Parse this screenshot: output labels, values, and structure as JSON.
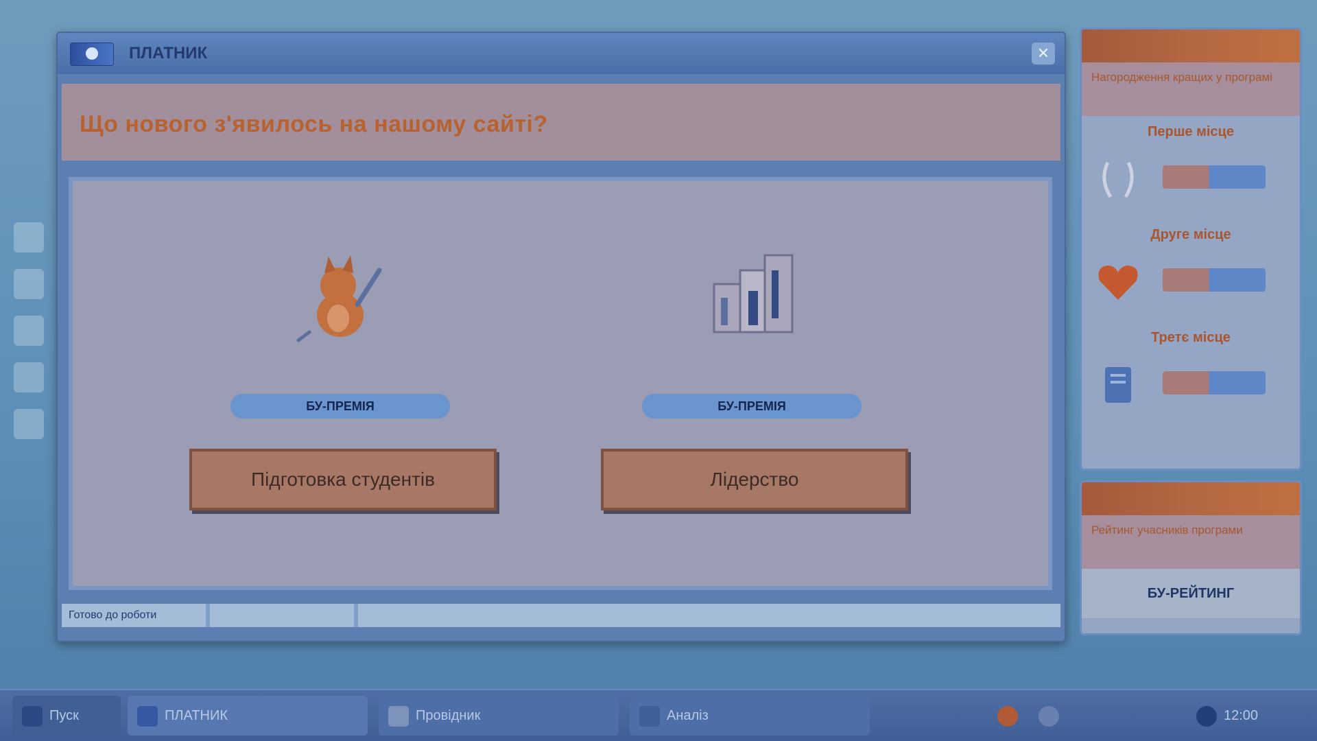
{
  "window": {
    "title": "ПЛАТНИК",
    "close_glyph": "✕"
  },
  "banner": {
    "text": "Що нового з'явилось на нашому сайті?"
  },
  "options": [
    {
      "badge": "БУ-ПРЕМІЯ",
      "button_label": "Підготовка студентів"
    },
    {
      "badge": "БУ-ПРЕМІЯ",
      "button_label": "Лідерство"
    }
  ],
  "statusbar": {
    "segments": [
      "Готово до роботи",
      "",
      ""
    ]
  },
  "right_panel": {
    "card1": {
      "subtitle": "Нагородження кращих у програмі",
      "prizes": [
        {
          "label": "Перше місце"
        },
        {
          "label": "Друге місце"
        },
        {
          "label": "Третє місце"
        }
      ]
    },
    "card2": {
      "subtitle": "Рейтинг учасників програми",
      "link": "БУ-РЕЙТИНГ"
    }
  },
  "taskbar": {
    "start": "Пуск",
    "items": [
      "ПЛАТНИК",
      "Провідник",
      "Аналіз"
    ],
    "tray_time": "12:00"
  },
  "colors": {
    "accent": "#b66a43",
    "badge": "#6a95cf",
    "window": "#5a7fb0"
  },
  "icons": {
    "app_logo": "app-logo-icon",
    "option1": "cat-with-bat-icon",
    "option2": "books-stack-icon",
    "prize1": "laurel-icon",
    "prize2": "heart-icon",
    "prize3": "document-icon"
  }
}
